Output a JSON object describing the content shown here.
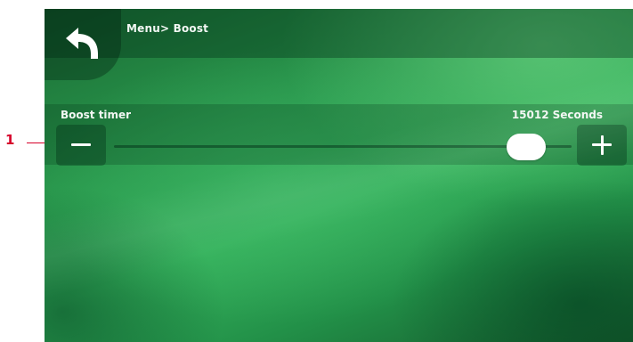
{
  "callout": {
    "number": "1",
    "color": "#d6002a"
  },
  "header": {
    "breadcrumb": "Menu> Boost",
    "back_icon": "back-arrow-icon"
  },
  "boost_timer": {
    "label": "Boost timer",
    "value": "15012",
    "unit": "Seconds",
    "slider_fraction": 0.9,
    "decrease_icon": "minus-icon",
    "increase_icon": "plus-icon"
  },
  "colors": {
    "background_green": "#2a9a4e",
    "text": "#f2f7f3"
  }
}
